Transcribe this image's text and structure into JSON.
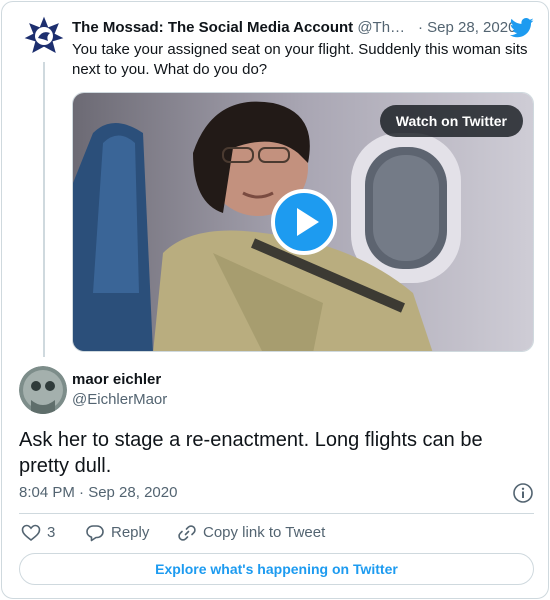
{
  "quoted_tweet": {
    "author_name": "The Mossad: The Social Media Account",
    "author_handle": "@Th…",
    "date": "· Sep 28, 2020",
    "text": "You take your assigned seat on your flight. Suddenly this woman sits next to you. What do you do?",
    "media": {
      "watch_label": "Watch on Twitter"
    }
  },
  "tweet": {
    "author_name": "maor eichler",
    "author_handle": "@EichlerMaor",
    "text": "Ask her to stage a re-enactment. Long flights can be pretty dull.",
    "timestamp": "8:04 PM · Sep 28, 2020"
  },
  "actions": {
    "like_count": "3",
    "reply_label": "Reply",
    "copy_label": "Copy link to Tweet"
  },
  "footer": {
    "explore_label": "Explore what's happening on Twitter"
  },
  "colors": {
    "accent": "#1d9bf0",
    "text_primary": "#0f1419",
    "text_secondary": "#536471",
    "border": "#cfd9de"
  }
}
